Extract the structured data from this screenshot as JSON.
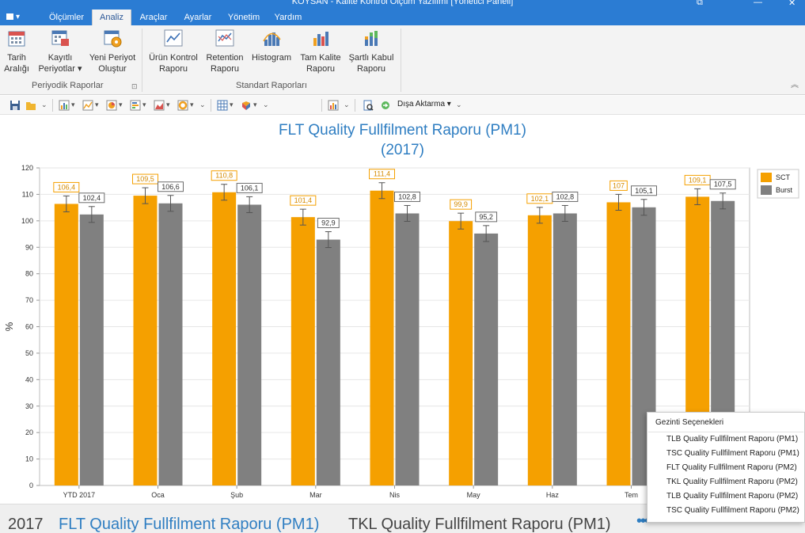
{
  "window": {
    "title": "KOYSAN - Kalite Kontrol Ölçüm Yazılımı [Yönetici Paneli]",
    "controls": [
      "⧉",
      "—",
      "✕"
    ]
  },
  "ribbon": {
    "tabs": [
      {
        "label": "Ölçümler"
      },
      {
        "label": "Analiz"
      },
      {
        "label": "Araçlar"
      },
      {
        "label": "Ayarlar"
      },
      {
        "label": "Yönetim"
      },
      {
        "label": "Yardım"
      }
    ],
    "buttons": [
      {
        "line1": "Tarih",
        "line2": "Aralığı"
      },
      {
        "line1": "Kayıtlı",
        "line2": "Periyotlar ▾"
      },
      {
        "line1": "Yeni Periyot",
        "line2": "Oluştur"
      },
      {
        "line1": "Ürün Kontrol",
        "line2": "Raporu"
      },
      {
        "line1": "Retention",
        "line2": "Raporu"
      },
      {
        "line1": "Histogram",
        "line2": ""
      },
      {
        "line1": "Tam Kalite",
        "line2": "Raporu"
      },
      {
        "line1": "Şartlı Kabul",
        "line2": "Raporu"
      }
    ],
    "groups": [
      {
        "label": "Periyodik Raporlar"
      },
      {
        "label": "Standart Raporları"
      }
    ],
    "launcher": "⊡",
    "collapse": "︽"
  },
  "toolbar": {
    "export_label": "Dışa Aktarma ▾",
    "dropdown_glyph": "▾",
    "chevron_glyph": "⌄"
  },
  "chart_data": {
    "type": "bar",
    "title_line1": "FLT Quality Fullfilment Raporu (PM1)",
    "title_line2": "(2017)",
    "xlabel": "",
    "ylabel": "%",
    "ylim": [
      0,
      120
    ],
    "ytick_step": 10,
    "grid": true,
    "legend_position": "top-right",
    "categories": [
      "YTD 2017",
      "Oca",
      "Şub",
      "Mar",
      "Nis",
      "May",
      "Haz",
      "Tem",
      ""
    ],
    "series": [
      {
        "name": "SCT",
        "color": "#f5a000",
        "labels_shown": [
          true,
          true,
          true,
          true,
          true,
          true,
          true,
          true,
          true
        ],
        "values": [
          106.4,
          109.5,
          110.8,
          101.4,
          111.4,
          99.9,
          102.1,
          107,
          109.1
        ],
        "labels": [
          "106,4",
          "109,5",
          "110,8",
          "101,4",
          "111,4",
          "99,9",
          "102,1",
          "107",
          "109,1"
        ]
      },
      {
        "name": "Burst",
        "color": "#808080",
        "values": [
          102.4,
          106.6,
          106.1,
          92.9,
          102.8,
          95.2,
          102.8,
          105.1,
          107.5
        ],
        "labels": [
          "102,4",
          "106,6",
          "106,1",
          "92,9",
          "102,8",
          "95,2",
          "102,8",
          "105,1",
          "107,5"
        ]
      }
    ],
    "error_bar": 3
  },
  "breadcrumb": {
    "items": [
      {
        "label": "2017"
      },
      {
        "label": "FLT Quality Fullfilment Raporu (PM1)"
      },
      {
        "label": "TKL Quality Fullfilment Raporu (PM1)"
      }
    ],
    "more": "•••"
  },
  "popup": {
    "header": "Gezinti Seçenekleri",
    "items": [
      "TLB Quality Fullfilment Raporu (PM1)",
      "TSC Quality Fullfilment Raporu (PM1)",
      "FLT Quality Fullfilment Raporu (PM2)",
      "TKL Quality Fullfilment Raporu (PM2)",
      "TLB Quality Fullfilment Raporu (PM2)",
      "TSC Quality Fullfilment Raporu (PM2)"
    ]
  }
}
